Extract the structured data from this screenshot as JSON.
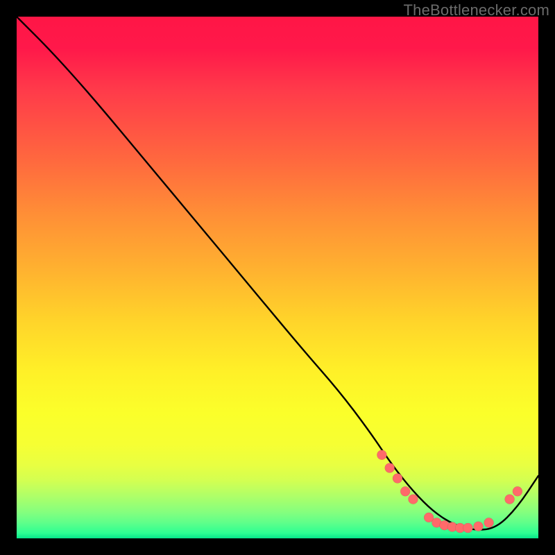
{
  "attribution": "TheBottlenecker.com",
  "chart_data": {
    "type": "line",
    "title": "",
    "xlabel": "",
    "ylabel": "",
    "xlim": [
      0,
      100
    ],
    "ylim": [
      0,
      100
    ],
    "series": [
      {
        "name": "bottleneck-curve",
        "x": [
          0,
          7,
          15,
          25,
          35,
          45,
          55,
          62,
          68,
          72,
          76,
          80,
          84,
          88,
          92,
          96,
          100
        ],
        "y": [
          100,
          93,
          84,
          72,
          60,
          48,
          36,
          28,
          20,
          14,
          9,
          5,
          2.5,
          1.5,
          2,
          6,
          12
        ]
      }
    ],
    "markers": {
      "name": "highlight-points",
      "points": [
        {
          "x": 70,
          "y": 16
        },
        {
          "x": 71.5,
          "y": 13.5
        },
        {
          "x": 73,
          "y": 11.5
        },
        {
          "x": 74.5,
          "y": 9
        },
        {
          "x": 76,
          "y": 7.5
        },
        {
          "x": 79,
          "y": 4
        },
        {
          "x": 80.5,
          "y": 3
        },
        {
          "x": 82,
          "y": 2.5
        },
        {
          "x": 83.5,
          "y": 2.2
        },
        {
          "x": 85,
          "y": 2
        },
        {
          "x": 86.5,
          "y": 2
        },
        {
          "x": 88.5,
          "y": 2.3
        },
        {
          "x": 90.5,
          "y": 3
        },
        {
          "x": 94.5,
          "y": 7.5
        },
        {
          "x": 96,
          "y": 9
        }
      ],
      "color": "#ff6a6a",
      "radius": 7
    },
    "background_gradient": {
      "direction": "vertical",
      "stops": [
        {
          "pos": 0.0,
          "color": "#ff1646"
        },
        {
          "pos": 0.5,
          "color": "#ffd32a"
        },
        {
          "pos": 0.82,
          "color": "#f6ff33"
        },
        {
          "pos": 1.0,
          "color": "#06e58a"
        }
      ]
    }
  }
}
